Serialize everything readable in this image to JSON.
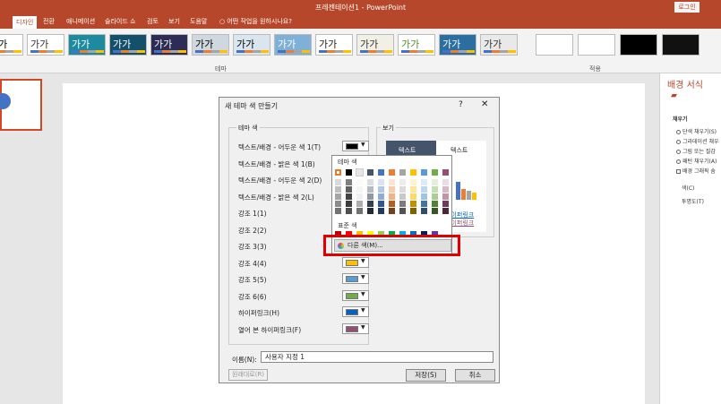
{
  "app": {
    "document_title": "프레젠테이션1 - PowerPoint",
    "login_label": "로그인"
  },
  "tabs": [
    "디자인",
    "전환",
    "애니메이션",
    "슬라이드 쇼",
    "검토",
    "보기",
    "도움말",
    "어떤 작업을 원하시나요?"
  ],
  "ribbon": {
    "thumb_text": "가가",
    "group_theme": "테마",
    "group_variants": "적용"
  },
  "format_pane": {
    "title": "배경 서식",
    "section": "채우기",
    "options": [
      "단색 채우기(S)",
      "그라데이션 채우",
      "그림 또는 질감",
      "패턴 채우기(A)",
      "배경 그래픽 숨"
    ],
    "color_label": "색(C)",
    "transparency_label": "투명도(T)"
  },
  "dialog": {
    "title": "새 테마 색 만들기",
    "help": "?",
    "close": "✕",
    "theme_colors_legend": "테마 색",
    "preview_legend": "보기",
    "rows": [
      {
        "label": "텍스트/배경 - 어두운 색 1(T)",
        "color": "#000000"
      },
      {
        "label": "텍스트/배경 - 밝은 색 1(B)",
        "color": "#ffffff"
      },
      {
        "label": "텍스트/배경 - 어두운 색 2(D)",
        "color": "#44546a"
      },
      {
        "label": "텍스트/배경 - 밝은 색 2(L)",
        "color": "#e7e6e6"
      },
      {
        "label": "강조 1(1)",
        "color": "#4472c4"
      },
      {
        "label": "강조 2(2)",
        "color": "#ed7d31"
      },
      {
        "label": "강조 3(3)",
        "color": "#a5a5a5"
      },
      {
        "label": "강조 4(4)",
        "color": "#ffc000"
      },
      {
        "label": "강조 5(5)",
        "color": "#5b9bd5"
      },
      {
        "label": "강조 6(6)",
        "color": "#70ad47"
      },
      {
        "label": "하이퍼링크(H)",
        "color": "#0563c1"
      },
      {
        "label": "열어 본 하이퍼링크(F)",
        "color": "#954f72"
      }
    ],
    "preview": {
      "text_label": "텍스트",
      "hyperlink": "하이퍼링크",
      "visited": "하이퍼링크"
    },
    "name_label": "이름(N):",
    "name_value": "사용자 지정 1",
    "reset_label": "원래대로(R)",
    "save_label": "저장(S)",
    "cancel_label": "취소"
  },
  "palette": {
    "theme_header": "테마 색",
    "standard_header": "표준 색",
    "more_colors": "다른 색(M)...",
    "theme_row": [
      "#ffffff",
      "#000000",
      "#e7e6e6",
      "#44546a",
      "#4472c4",
      "#ed7d31",
      "#a5a5a5",
      "#ffc000",
      "#5b9bd5",
      "#70ad47",
      "#954f72"
    ],
    "standard_row": [
      "#c00000",
      "#ff0000",
      "#ffc000",
      "#ffff00",
      "#92d050",
      "#00b050",
      "#00b0f0",
      "#0070c0",
      "#002060",
      "#7030a0"
    ]
  }
}
